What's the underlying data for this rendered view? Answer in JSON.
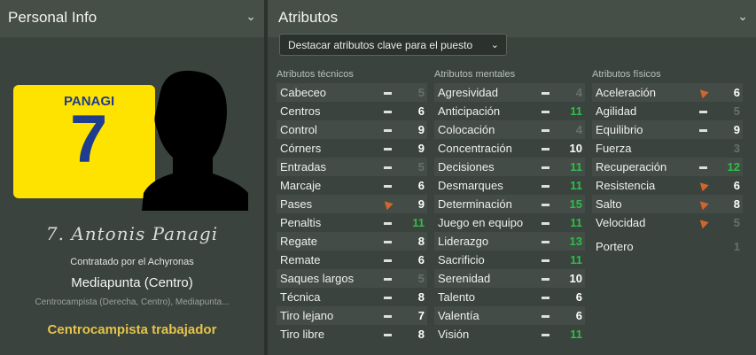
{
  "left": {
    "title": "Personal Info",
    "shirt_name": "PANAGI",
    "shirt_number": "7",
    "signature": "7. Antonis Panagi",
    "contract": "Contratado por el Achyronas",
    "position": "Mediapunta (Centro)",
    "positions_sub": "Centrocampista (Derecha, Centro), Mediapunta...",
    "personality": "Centrocampista trabajador"
  },
  "right": {
    "title": "Atributos",
    "dropdown": "Destacar atributos clave para el puesto",
    "tech_title": "Atributos técnicos",
    "mental_title": "Atributos mentales",
    "phys_title": "Atributos físicos",
    "tech": [
      {
        "name": "Cabeceo",
        "value": "5",
        "ind": "bar",
        "style": "d"
      },
      {
        "name": "Centros",
        "value": "6",
        "ind": "bar",
        "style": "w"
      },
      {
        "name": "Control",
        "value": "9",
        "ind": "bar",
        "style": "w"
      },
      {
        "name": "Córners",
        "value": "9",
        "ind": "bar",
        "style": "w"
      },
      {
        "name": "Entradas",
        "value": "5",
        "ind": "bar",
        "style": "d"
      },
      {
        "name": "Marcaje",
        "value": "6",
        "ind": "bar",
        "style": "w"
      },
      {
        "name": "Pases",
        "value": "9",
        "ind": "arrow",
        "style": "w"
      },
      {
        "name": "Penaltis",
        "value": "11",
        "ind": "bar",
        "style": "g"
      },
      {
        "name": "Regate",
        "value": "8",
        "ind": "bar",
        "style": "w"
      },
      {
        "name": "Remate",
        "value": "6",
        "ind": "bar",
        "style": "w"
      },
      {
        "name": "Saques largos",
        "value": "5",
        "ind": "bar",
        "style": "d"
      },
      {
        "name": "Técnica",
        "value": "8",
        "ind": "bar",
        "style": "w"
      },
      {
        "name": "Tiro lejano",
        "value": "7",
        "ind": "bar",
        "style": "w"
      },
      {
        "name": "Tiro libre",
        "value": "8",
        "ind": "bar",
        "style": "w"
      }
    ],
    "mental": [
      {
        "name": "Agresividad",
        "value": "4",
        "ind": "bar",
        "style": "d"
      },
      {
        "name": "Anticipación",
        "value": "11",
        "ind": "bar",
        "style": "g"
      },
      {
        "name": "Colocación",
        "value": "4",
        "ind": "bar",
        "style": "d"
      },
      {
        "name": "Concentración",
        "value": "10",
        "ind": "bar",
        "style": "w"
      },
      {
        "name": "Decisiones",
        "value": "11",
        "ind": "bar",
        "style": "g"
      },
      {
        "name": "Desmarques",
        "value": "11",
        "ind": "bar",
        "style": "g"
      },
      {
        "name": "Determinación",
        "value": "15",
        "ind": "bar",
        "style": "g"
      },
      {
        "name": "Juego en equipo",
        "value": "11",
        "ind": "bar",
        "style": "g"
      },
      {
        "name": "Liderazgo",
        "value": "13",
        "ind": "bar",
        "style": "g"
      },
      {
        "name": "Sacrificio",
        "value": "11",
        "ind": "bar",
        "style": "g"
      },
      {
        "name": "Serenidad",
        "value": "10",
        "ind": "bar",
        "style": "w"
      },
      {
        "name": "Talento",
        "value": "6",
        "ind": "bar",
        "style": "w"
      },
      {
        "name": "Valentía",
        "value": "6",
        "ind": "bar",
        "style": "w"
      },
      {
        "name": "Visión",
        "value": "11",
        "ind": "bar",
        "style": "g"
      }
    ],
    "phys": [
      {
        "name": "Aceleración",
        "value": "6",
        "ind": "arrow",
        "style": "w"
      },
      {
        "name": "Agilidad",
        "value": "5",
        "ind": "bar",
        "style": "d"
      },
      {
        "name": "Equilibrio",
        "value": "9",
        "ind": "bar",
        "style": "w"
      },
      {
        "name": "Fuerza",
        "value": "3",
        "ind": "",
        "style": "d"
      },
      {
        "name": "Recuperación",
        "value": "12",
        "ind": "bar",
        "style": "g"
      },
      {
        "name": "Resistencia",
        "value": "6",
        "ind": "arrow",
        "style": "w"
      },
      {
        "name": "Salto",
        "value": "8",
        "ind": "arrow",
        "style": "w"
      },
      {
        "name": "Velocidad",
        "value": "5",
        "ind": "arrow",
        "style": "d"
      }
    ],
    "goalkeeper": {
      "name": "Portero",
      "value": "1"
    }
  }
}
